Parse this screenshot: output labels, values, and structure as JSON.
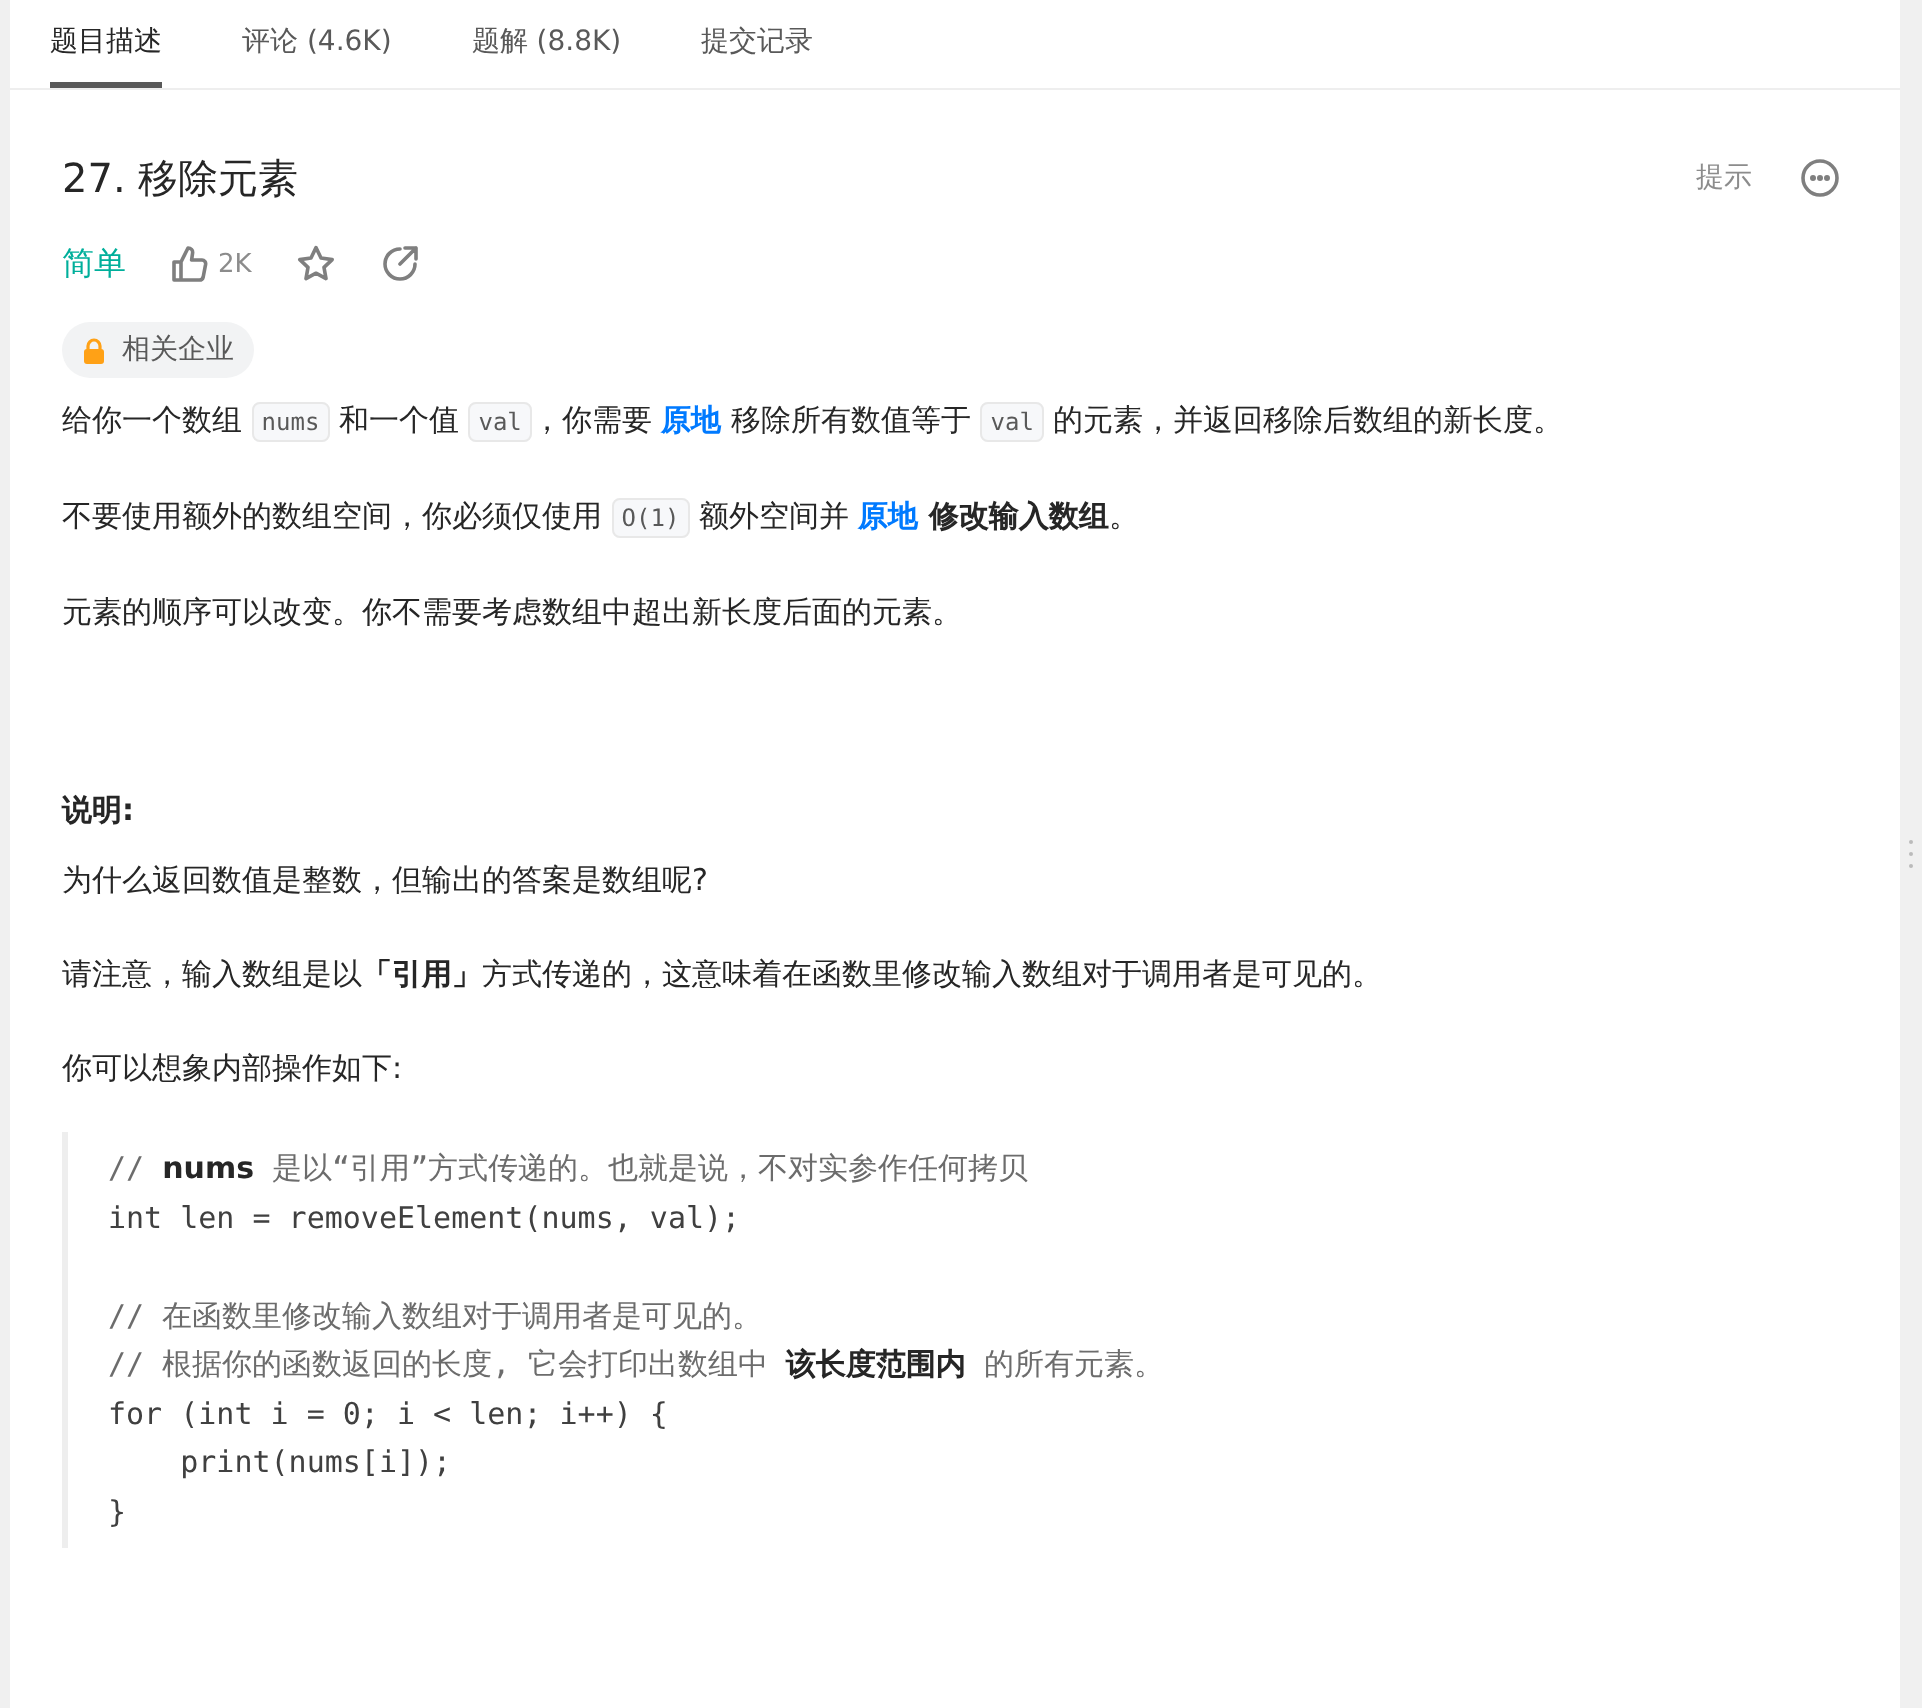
{
  "tabs": [
    {
      "label": "题目描述",
      "selected": true
    },
    {
      "label": "评论 (4.6K)",
      "selected": false
    },
    {
      "label": "题解 (8.8K)",
      "selected": false
    },
    {
      "label": "提交记录",
      "selected": false
    }
  ],
  "title": "27. 移除元素",
  "hint": "提示",
  "difficulty": "简单",
  "likes": "2K",
  "company_tag": "相关企业",
  "description": [
    [
      {
        "kind": "text",
        "text": "给你一个数组 "
      },
      {
        "kind": "code",
        "text": "nums"
      },
      {
        "kind": "text",
        "text": " 和一个值 "
      },
      {
        "kind": "code",
        "text": "val"
      },
      {
        "kind": "text",
        "text": "，你需要 "
      },
      {
        "kind": "highlight",
        "text": "原地"
      },
      {
        "kind": "text",
        "text": " 移除所有数值等于 "
      },
      {
        "kind": "code",
        "text": "val"
      },
      {
        "kind": "text",
        "text": " 的元素，并返回移除后数组的新长度。"
      }
    ],
    [
      {
        "kind": "text",
        "text": "不要使用额外的数组空间，你必须仅使用 "
      },
      {
        "kind": "code",
        "text": "O(1)"
      },
      {
        "kind": "text",
        "text": " 额外空间并 "
      },
      {
        "kind": "highlight",
        "text": "原地"
      },
      {
        "kind": "bold",
        "text": " 修改输入数组"
      },
      {
        "kind": "text",
        "text": "。"
      }
    ],
    [
      {
        "kind": "text",
        "text": "元素的顺序可以改变。你不需要考虑数组中超出新长度后面的元素。"
      }
    ]
  ],
  "note_heading": "说明:",
  "notes": [
    "为什么返回数值是整数，但输出的答案是数组呢?",
    "请注意，输入数组是以**「引用」**方式传递的，这意味着在函数里修改输入数组对于调用者是可见的。",
    "你可以想象内部操作如下:"
  ],
  "code_lines": [
    {
      "kind": "comment",
      "text": "// **nums** 是以“引用”方式传递的。也就是说，不对实参作任何拷贝"
    },
    {
      "kind": "code",
      "text": "int len = removeElement(nums, val);"
    },
    {
      "kind": "blank"
    },
    {
      "kind": "comment",
      "text": "// 在函数里修改输入数组对于调用者是可见的。"
    },
    {
      "kind": "comment",
      "text": "// 根据你的函数返回的长度, 它会打印出数组中 **该长度范围内** 的所有元素。"
    },
    {
      "kind": "code",
      "text": "for (int i = 0; i < len; i++) {"
    },
    {
      "kind": "code",
      "text": "    print(nums[i]);"
    },
    {
      "kind": "code",
      "text": "}"
    }
  ]
}
